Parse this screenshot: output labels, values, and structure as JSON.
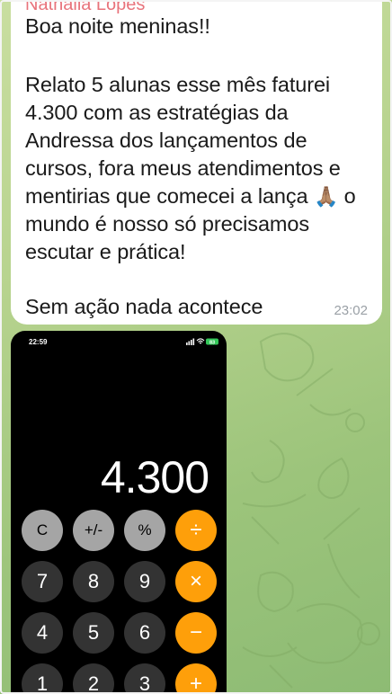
{
  "message": {
    "sender": "Nathalia Lopes",
    "lines": [
      "Boa noite meninas!!",
      "",
      "Relato 5 alunas esse mês faturei",
      "4.300 com as estratégias da",
      "Andressa dos lançamentos de",
      "cursos, fora meus atendimentos e",
      "mentirias que comecei a lança",
      "mundo é nosso só precisamos",
      "escutar e prática!",
      "",
      "Sem ação nada acontece"
    ],
    "emoji": "🙏🏽",
    "line7_after_emoji": " o",
    "time": "23:02"
  },
  "photo": {
    "status_time": "22:59",
    "battery": "83",
    "display": "4.300",
    "buttons": [
      {
        "label": "C",
        "style": "gray"
      },
      {
        "label": "+/-",
        "style": "gray"
      },
      {
        "label": "%",
        "style": "gray"
      },
      {
        "label": "÷",
        "style": "orange"
      },
      {
        "label": "7",
        "style": "dark"
      },
      {
        "label": "8",
        "style": "dark"
      },
      {
        "label": "9",
        "style": "dark"
      },
      {
        "label": "×",
        "style": "orange"
      },
      {
        "label": "4",
        "style": "dark"
      },
      {
        "label": "5",
        "style": "dark"
      },
      {
        "label": "6",
        "style": "dark"
      },
      {
        "label": "−",
        "style": "orange"
      },
      {
        "label": "1",
        "style": "dark"
      },
      {
        "label": "2",
        "style": "dark"
      },
      {
        "label": "3",
        "style": "dark"
      },
      {
        "label": "+",
        "style": "orange"
      }
    ]
  },
  "colors": {
    "sender": "#e8737b",
    "orange": "#fe9f0a",
    "gray": "#a5a5a5",
    "dark": "#333333",
    "battery": "#34c759"
  }
}
